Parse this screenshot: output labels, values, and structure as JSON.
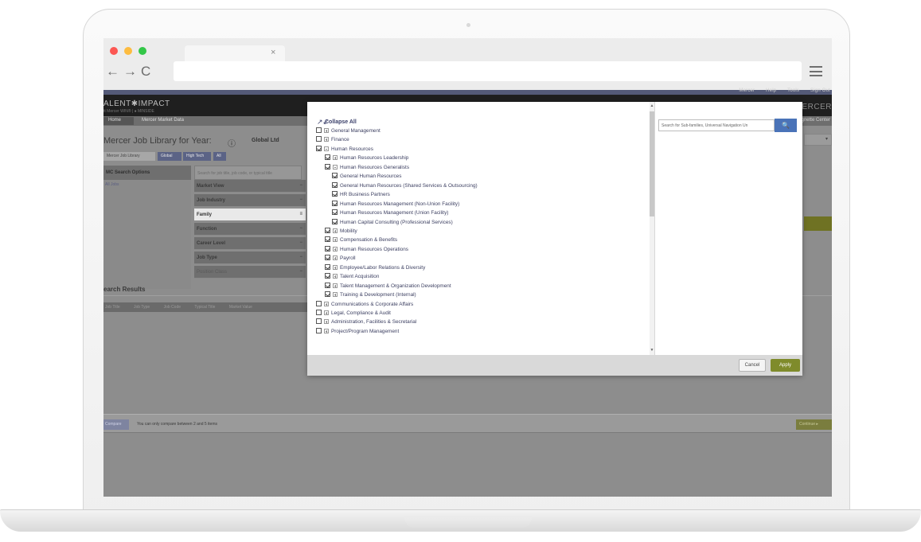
{
  "browser": {
    "tab_close": "×",
    "back": "←",
    "forward": "→",
    "reload": "C"
  },
  "app": {
    "top_links": [
      "Mercer",
      "Help",
      "Tools",
      "Sign Out"
    ],
    "logo": "ALENT✱IMPACT",
    "logo_sub": "tt Mercer WIN® | ● MINSIDE",
    "brand_right": "✱ MERCER",
    "breadcrumbs": [
      "Home",
      "Mercer Market Data"
    ],
    "crumb_right": "Vignette Center",
    "page_title": "Mercer Job Library for Year:",
    "title_icon": "ⓘ",
    "title_value": "Global Ltd",
    "filter_tabs": [
      "Mercer Job Library",
      "Global",
      "High Tech",
      "All"
    ],
    "search_options_header": "MC Search Options",
    "left_link": "All Jobs",
    "search_placeholder": "Search for job title, job code, or typical title",
    "facets": [
      {
        "label": "Market View",
        "exp": "−",
        "state": ""
      },
      {
        "label": "Job Industry",
        "exp": "−",
        "state": ""
      },
      {
        "label": "Family",
        "exp": "≡",
        "state": "active"
      },
      {
        "label": "Function",
        "exp": "−",
        "state": ""
      },
      {
        "label": "Career Level",
        "exp": "−",
        "state": ""
      },
      {
        "label": "Job Type",
        "exp": "−",
        "state": ""
      },
      {
        "label": "Position Class",
        "exp": "−",
        "state": "dim"
      }
    ],
    "results_title": "earch Results",
    "results_columns": [
      "Job Title",
      "Job Type",
      "Job Code",
      "Typical Title",
      "Market Value"
    ],
    "compare_button": "Compare",
    "compare_note": "You can only compare between 2 and 5 items",
    "confirm_button": "Continue ▸"
  },
  "modal": {
    "collapse_all": "Collapse All",
    "collapse_icon": "↗↙",
    "tree": [
      {
        "label": "General Management",
        "checked": false,
        "indent": 0,
        "toggle": "plus"
      },
      {
        "label": "Finance",
        "checked": false,
        "indent": 0,
        "toggle": "plus"
      },
      {
        "label": "Human Resources",
        "checked": true,
        "indent": 0,
        "toggle": "minus"
      },
      {
        "label": "Human Resources Leadership",
        "checked": true,
        "indent": 1,
        "toggle": "plus"
      },
      {
        "label": "Human Resources Generalists",
        "checked": true,
        "indent": 1,
        "toggle": "minus"
      },
      {
        "label": "General Human Resources",
        "checked": true,
        "indent": 2,
        "toggle": ""
      },
      {
        "label": "General Human Resources (Shared Services & Outsourcing)",
        "checked": true,
        "indent": 2,
        "toggle": ""
      },
      {
        "label": "HR Business Partners",
        "checked": true,
        "indent": 2,
        "toggle": ""
      },
      {
        "label": "Human Resources Management (Non-Union Facility)",
        "checked": true,
        "indent": 2,
        "toggle": ""
      },
      {
        "label": "Human Resources Management (Union Facility)",
        "checked": true,
        "indent": 2,
        "toggle": ""
      },
      {
        "label": "Human Capital Consulting (Professional Services)",
        "checked": true,
        "indent": 2,
        "toggle": ""
      },
      {
        "label": "Mobility",
        "checked": true,
        "indent": 1,
        "toggle": "plus"
      },
      {
        "label": "Compensation & Benefits",
        "checked": true,
        "indent": 1,
        "toggle": "plus"
      },
      {
        "label": "Human Resources Operations",
        "checked": true,
        "indent": 1,
        "toggle": "plus"
      },
      {
        "label": "Payroll",
        "checked": true,
        "indent": 1,
        "toggle": "plus"
      },
      {
        "label": "Employee/Labor Relations & Diversity",
        "checked": true,
        "indent": 1,
        "toggle": "plus"
      },
      {
        "label": "Talent Acquisition",
        "checked": true,
        "indent": 1,
        "toggle": "plus"
      },
      {
        "label": "Talent Management & Organization Development",
        "checked": true,
        "indent": 1,
        "toggle": "plus"
      },
      {
        "label": "Training & Development (Internal)",
        "checked": true,
        "indent": 1,
        "toggle": "plus"
      },
      {
        "label": "Communications & Corporate Affairs",
        "checked": false,
        "indent": 0,
        "toggle": "plus"
      },
      {
        "label": "Legal, Compliance & Audit",
        "checked": false,
        "indent": 0,
        "toggle": "plus"
      },
      {
        "label": "Administration, Facilities & Secretarial",
        "checked": false,
        "indent": 0,
        "toggle": "plus"
      },
      {
        "label": "Project/Program Management",
        "checked": false,
        "indent": 0,
        "toggle": "plus"
      }
    ],
    "sub_search_placeholder": "Search for Sub-families, Universal Navigation Un",
    "search_icon": "🔍",
    "scroll_up": "▲",
    "scroll_down": "▼",
    "cancel": "Cancel",
    "apply": "Apply"
  },
  "colors": {
    "accent_green": "#7f8b2b",
    "search_blue": "#4a73b8",
    "header_navy": "#545a78"
  }
}
